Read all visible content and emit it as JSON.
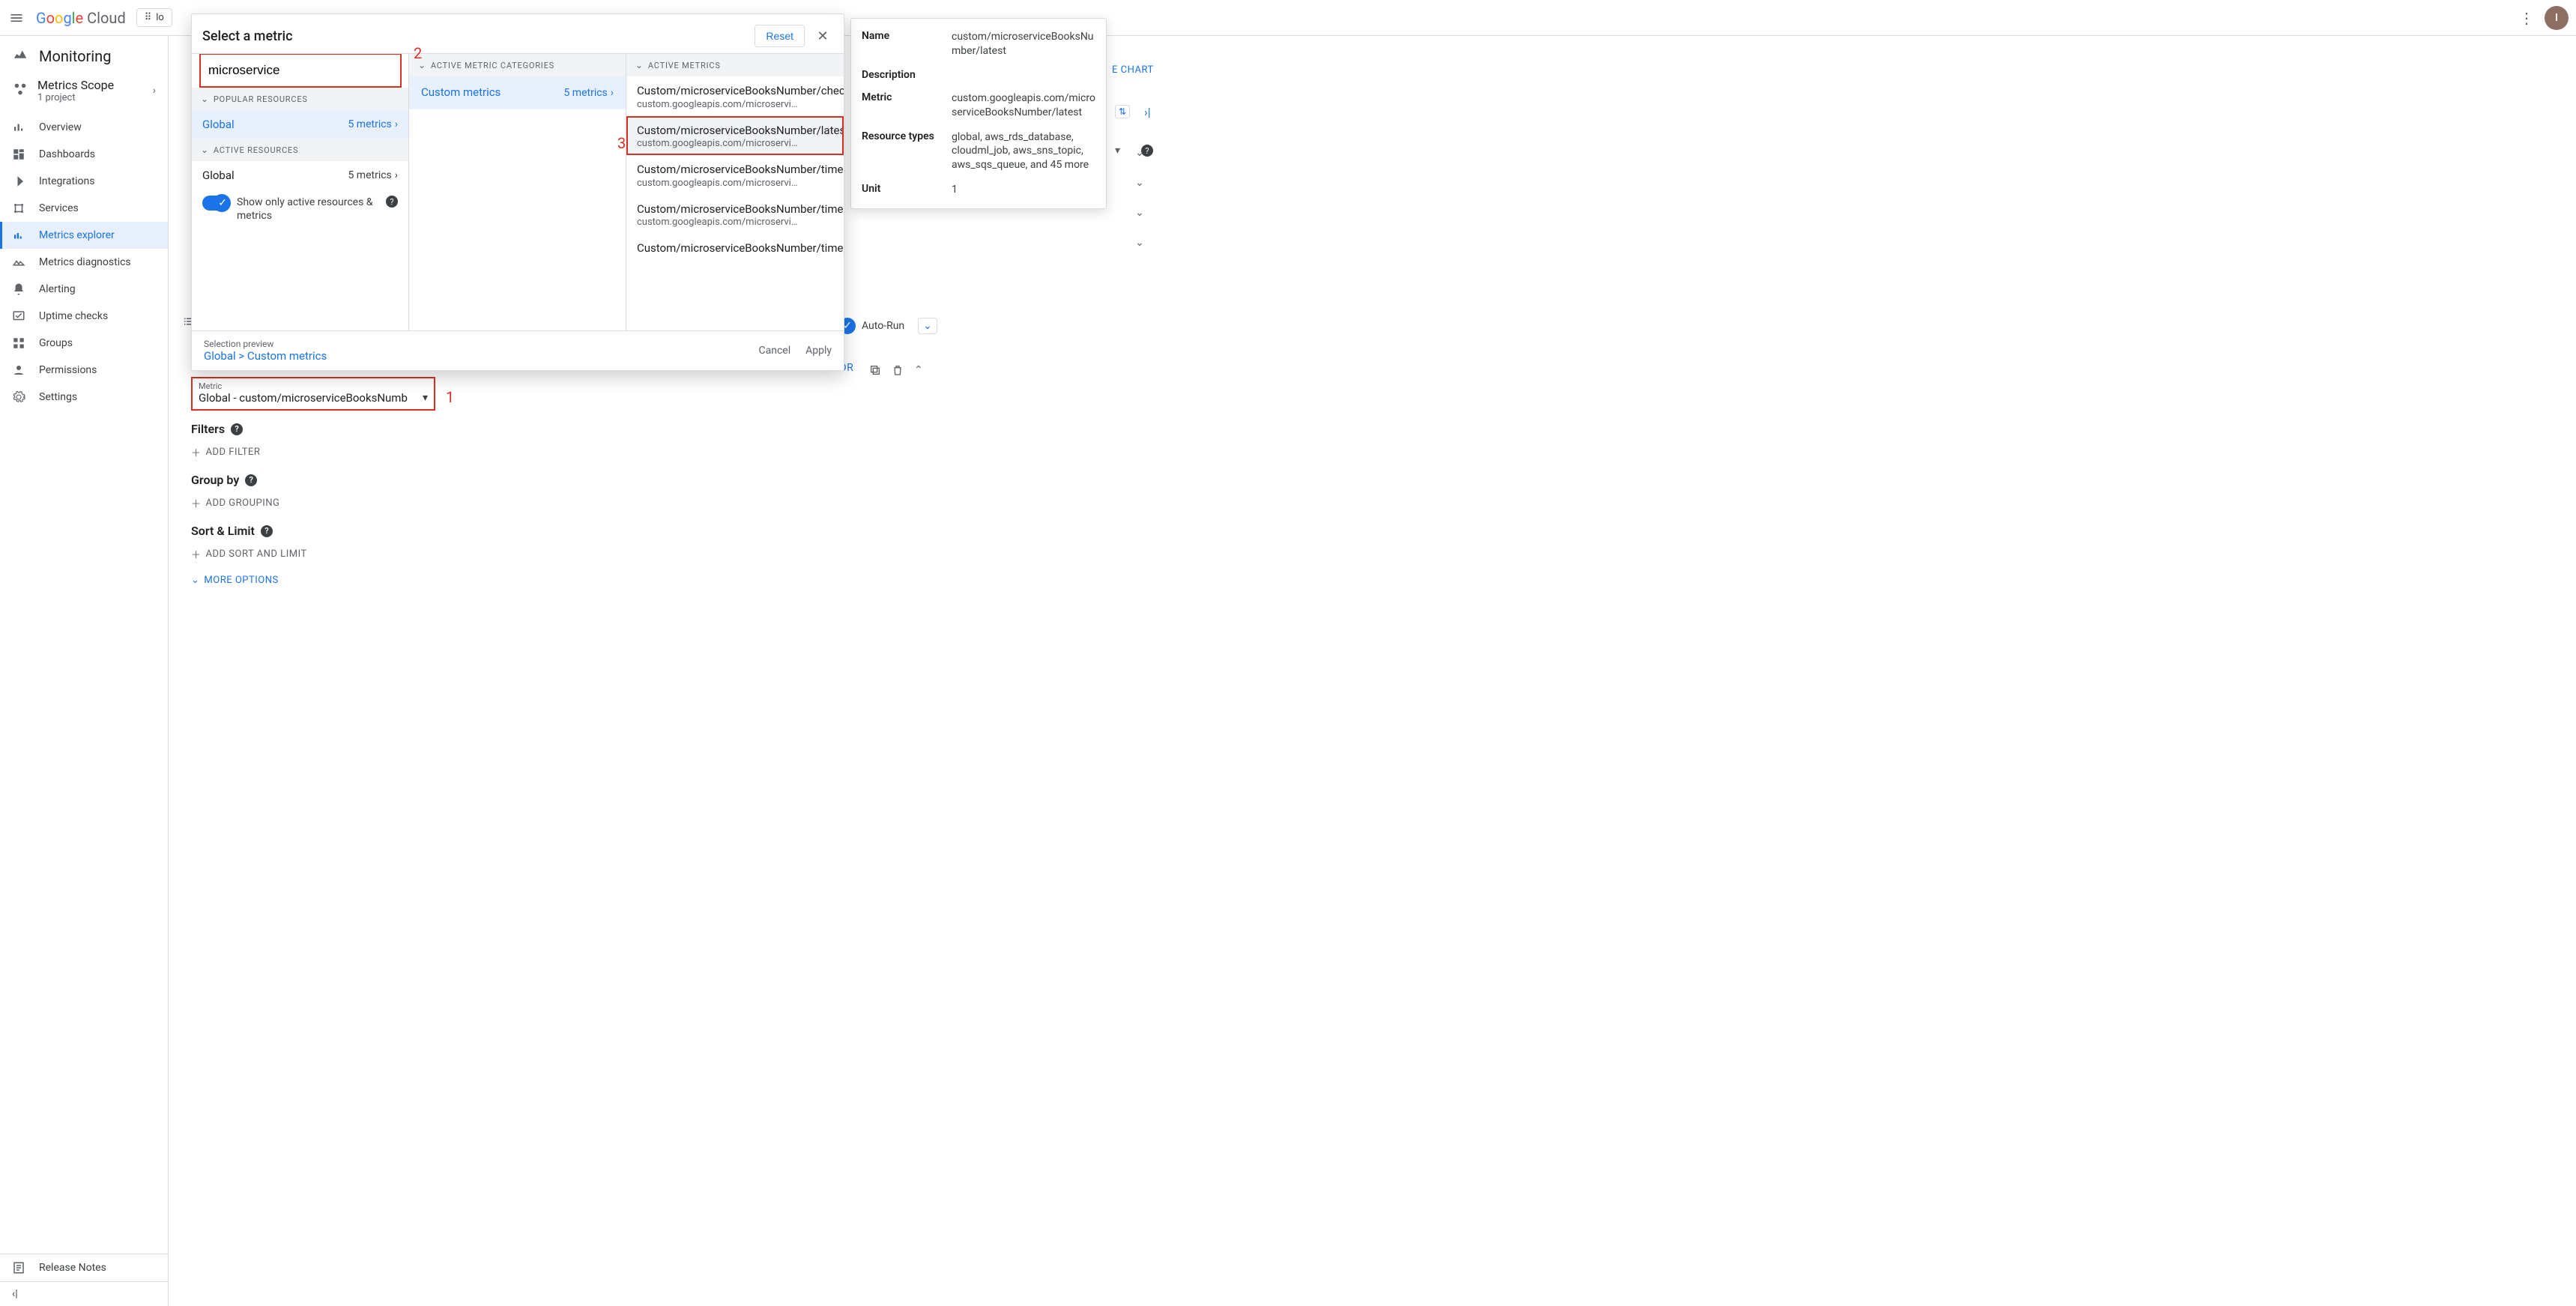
{
  "topbar": {
    "logo_cloud": "Cloud",
    "project_selector_prefix": "lo",
    "avatar_initial": "I",
    "more_icon": "more-vert-icon"
  },
  "sidenav": {
    "title": "Monitoring",
    "scope_title": "Metrics Scope",
    "scope_subtitle": "1 project",
    "items": [
      {
        "label": "Overview"
      },
      {
        "label": "Dashboards"
      },
      {
        "label": "Integrations"
      },
      {
        "label": "Services"
      },
      {
        "label": "Metrics explorer"
      },
      {
        "label": "Metrics diagnostics"
      },
      {
        "label": "Alerting"
      },
      {
        "label": "Uptime checks"
      },
      {
        "label": "Groups"
      },
      {
        "label": "Permissions"
      },
      {
        "label": "Settings"
      }
    ],
    "footer": "Release Notes"
  },
  "metric_dialog": {
    "title": "Select a metric",
    "reset": "Reset",
    "search_value": "microservice",
    "sections": {
      "popular": "POPULAR RESOURCES",
      "active_cat": "ACTIVE METRIC CATEGORIES",
      "active_metrics": "ACTIVE METRICS",
      "active_res": "ACTIVE RESOURCES"
    },
    "global_label": "Global",
    "global_count": "5 metrics",
    "toggle_label": "Show only active resources & metrics",
    "category": {
      "label": "Custom metrics",
      "count": "5 metrics"
    },
    "metrics": [
      {
        "name": "Custom/microserviceBooksNumber/checks",
        "path": "custom.googleapis.com/microservi…"
      },
      {
        "name": "Custom/microserviceBooksNumber/latest",
        "path": "custom.googleapis.com/microservi…"
      },
      {
        "name": "Custom/microserviceBooksNumber/time",
        "path": "custom.googleapis.com/microservi…"
      },
      {
        "name": "Custom/microserviceBooksNumber/time/count",
        "path": "custom.googleapis.com/microservi…"
      },
      {
        "name": "Custom/microserviceBooksNumber/time/max",
        "path": ""
      }
    ],
    "preview_label": "Selection preview",
    "preview_path": "Global > Custom metrics",
    "cancel": "Cancel",
    "apply": "Apply"
  },
  "metric_box": {
    "label": "Metric",
    "value": "Global - custom/microserviceBooksNumb"
  },
  "builder": {
    "filters": "Filters",
    "add_filter": "ADD FILTER",
    "group_by": "Group by",
    "add_grouping": "ADD GROUPING",
    "sort_limit": "Sort & Limit",
    "add_sort": "ADD SORT AND LIMIT",
    "more_options": "MORE OPTIONS"
  },
  "autorun_label": "Auto-Run",
  "or_label": "OR",
  "save_chart": "E CHART",
  "right_panel": {
    "rows": [
      {
        "k": "Name",
        "v": "custom/microserviceBooksNumber/latest"
      },
      {
        "k": "Description",
        "v": ""
      },
      {
        "k": "Metric",
        "v": "custom.googleapis.com/microserviceBooksNumber/latest"
      },
      {
        "k": "Resource types",
        "v": "global, aws_rds_database, cloudml_job, aws_sns_topic, aws_sqs_queue, and 45 more"
      },
      {
        "k": "Unit",
        "v": "1"
      }
    ]
  },
  "annotations": {
    "n1": "1",
    "n2": "2",
    "n3": "3"
  }
}
